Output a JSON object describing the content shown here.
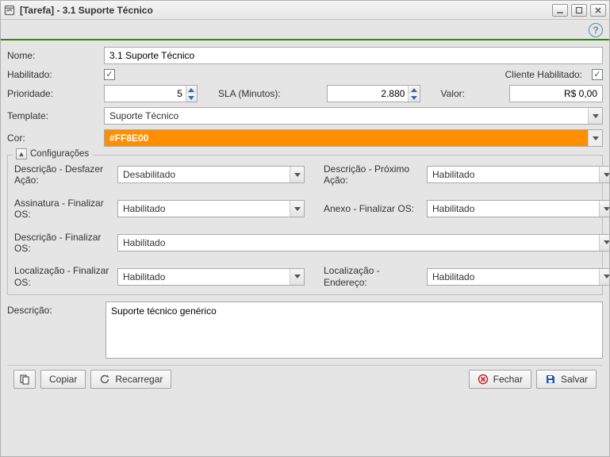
{
  "window": {
    "title": "[Tarefa] - 3.1 Suporte Técnico"
  },
  "labels": {
    "nome": "Nome:",
    "habilitado": "Habilitado:",
    "cliente_habilitado": "Cliente Habilitado:",
    "prioridade": "Prioridade:",
    "sla": "SLA (Minutos):",
    "valor": "Valor:",
    "template": "Template:",
    "cor": "Cor:",
    "configuracoes": "Configurações",
    "desfazer": "Descrição - Desfazer Ação:",
    "proximo": "Descrição - Próximo Ação:",
    "assinatura": "Assinatura - Finalizar OS:",
    "anexo": "Anexo - Finalizar OS:",
    "desc_finalizar": "Descrição - Finalizar OS:",
    "loc_finalizar": "Localização - Finalizar OS:",
    "loc_endereco": "Localização - Endereço:",
    "descricao": "Descrição:"
  },
  "values": {
    "nome": "3.1 Suporte Técnico",
    "habilitado": true,
    "cliente_habilitado": true,
    "prioridade": "5",
    "sla": "2.880",
    "valor": "R$ 0,00",
    "template": "Suporte Técnico",
    "cor": "#FF8E00",
    "desfazer": "Desabilitado",
    "proximo": "Habilitado",
    "assinatura": "Habilitado",
    "anexo": "Habilitado",
    "desc_finalizar": "Habilitado",
    "loc_finalizar": "Habilitado",
    "loc_endereco": "Habilitado",
    "descricao": "Suporte técnico genérico"
  },
  "buttons": {
    "copiar": "Copiar",
    "recarregar": "Recarregar",
    "fechar": "Fechar",
    "salvar": "Salvar"
  },
  "help_glyph": "?"
}
